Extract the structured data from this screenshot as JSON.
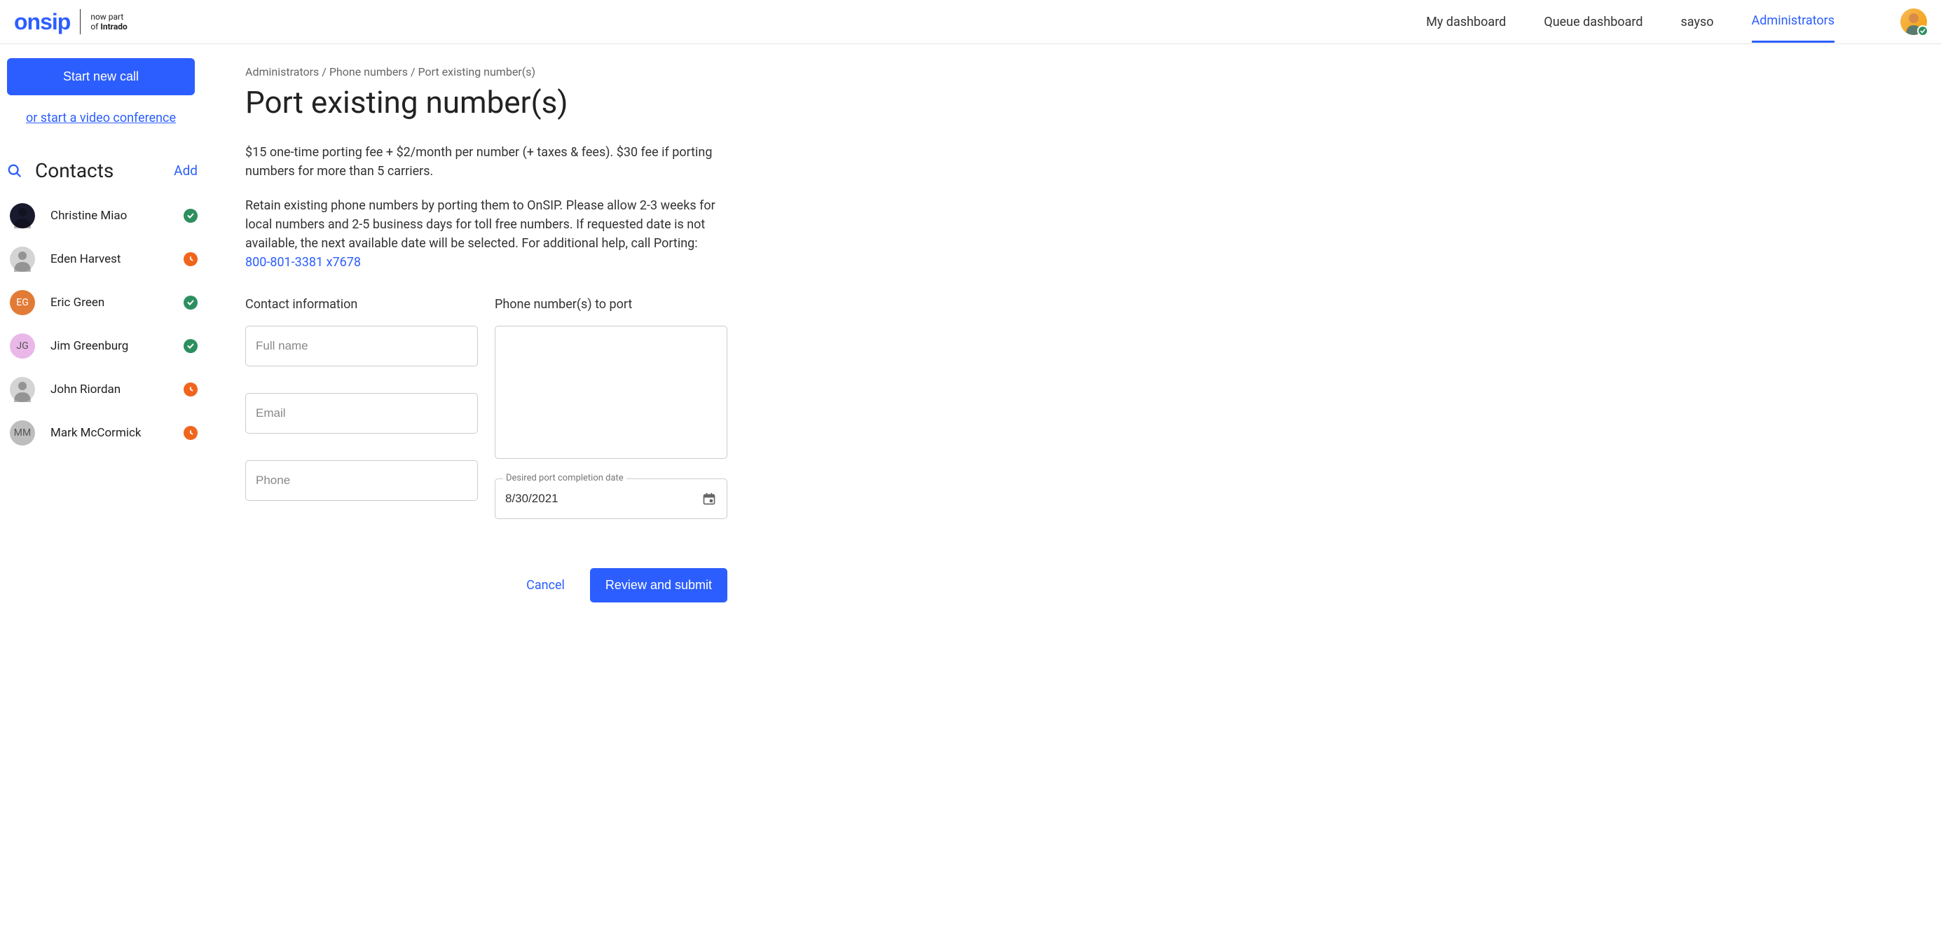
{
  "header": {
    "logo_text": "onsip",
    "tagline_line1": "now part",
    "tagline_line2": "of Intrado",
    "nav": [
      {
        "label": "My dashboard",
        "active": false
      },
      {
        "label": "Queue dashboard",
        "active": false
      },
      {
        "label": "sayso",
        "active": false
      },
      {
        "label": "Administrators",
        "active": true
      }
    ]
  },
  "sidebar": {
    "start_call_label": "Start new call",
    "video_link_label": "or start a video conference",
    "contacts_title": "Contacts",
    "add_label": "Add",
    "contacts": [
      {
        "name": "Christine Miao",
        "status": "green",
        "avatar_type": "photo",
        "avatar_bg": "#1a1a2e",
        "initials": ""
      },
      {
        "name": "Eden Harvest",
        "status": "orange",
        "avatar_type": "photo",
        "avatar_bg": "#d4d4d4",
        "initials": ""
      },
      {
        "name": "Eric Green",
        "status": "green",
        "avatar_type": "initials",
        "avatar_bg": "#e27b36",
        "initials": "EG"
      },
      {
        "name": "Jim Greenburg",
        "status": "green",
        "avatar_type": "initials",
        "avatar_bg": "#e9b8e8",
        "initials": "JG"
      },
      {
        "name": "John Riordan",
        "status": "orange",
        "avatar_type": "photo",
        "avatar_bg": "#d4d4d4",
        "initials": ""
      },
      {
        "name": "Mark McCormick",
        "status": "orange",
        "avatar_type": "initials",
        "avatar_bg": "#bdbdbd",
        "initials": "MM"
      }
    ]
  },
  "main": {
    "breadcrumb": "Administrators / Phone numbers / Port existing number(s)",
    "title": "Port existing number(s)",
    "desc1": "$15 one-time porting fee + $2/month per number (+ taxes & fees). $30 fee if porting numbers for more than 5 carriers.",
    "desc2_prefix": "Retain existing phone numbers by porting them to OnSIP. Please allow 2-3 weeks for local numbers and 2-5 business days for toll free numbers. If requested date is not available, the next available date will be selected. For additional help, call Porting: ",
    "desc2_link": "800-801-3381 x7678",
    "form": {
      "contact_section_label": "Contact information",
      "phone_section_label": "Phone number(s) to port",
      "fullname_placeholder": "Full name",
      "email_placeholder": "Email",
      "phone_placeholder": "Phone",
      "date_label": "Desired port completion date",
      "date_value": "8/30/2021",
      "cancel_label": "Cancel",
      "submit_label": "Review and submit"
    }
  }
}
